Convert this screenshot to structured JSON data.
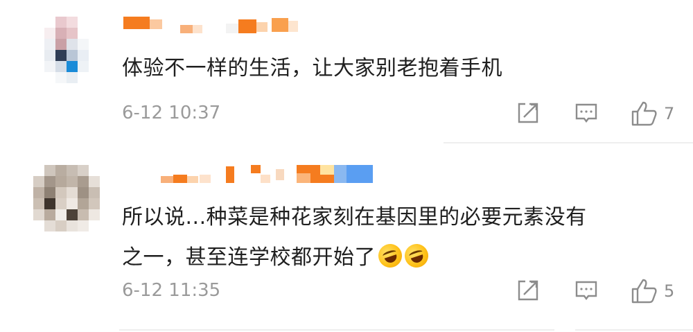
{
  "comments": [
    {
      "text_lines": [
        "体验不一样的生活，让大家别老抱着手机"
      ],
      "time": "6-12 10:37",
      "like_count": "7",
      "icons": {
        "share": "share-icon",
        "reply": "comment-icon",
        "like": "thumbs-up-icon"
      }
    },
    {
      "text_lines": [
        "所以说...种菜是种花家刻在基因里的必要元素没有",
        "之一，甚至连学校都开始了"
      ],
      "emojis": [
        "rofl-emoji",
        "rofl-emoji"
      ],
      "time": "6-12 11:35",
      "like_count": "5",
      "icons": {
        "share": "share-icon",
        "reply": "comment-icon",
        "like": "thumbs-up-icon"
      }
    }
  ],
  "colors": {
    "text": "#1f1f1f",
    "meta": "#9a9a9a",
    "icon": "#8c8c8c",
    "divider": "#eeeeee",
    "username_mosaic_orange": "#f57c1f"
  }
}
